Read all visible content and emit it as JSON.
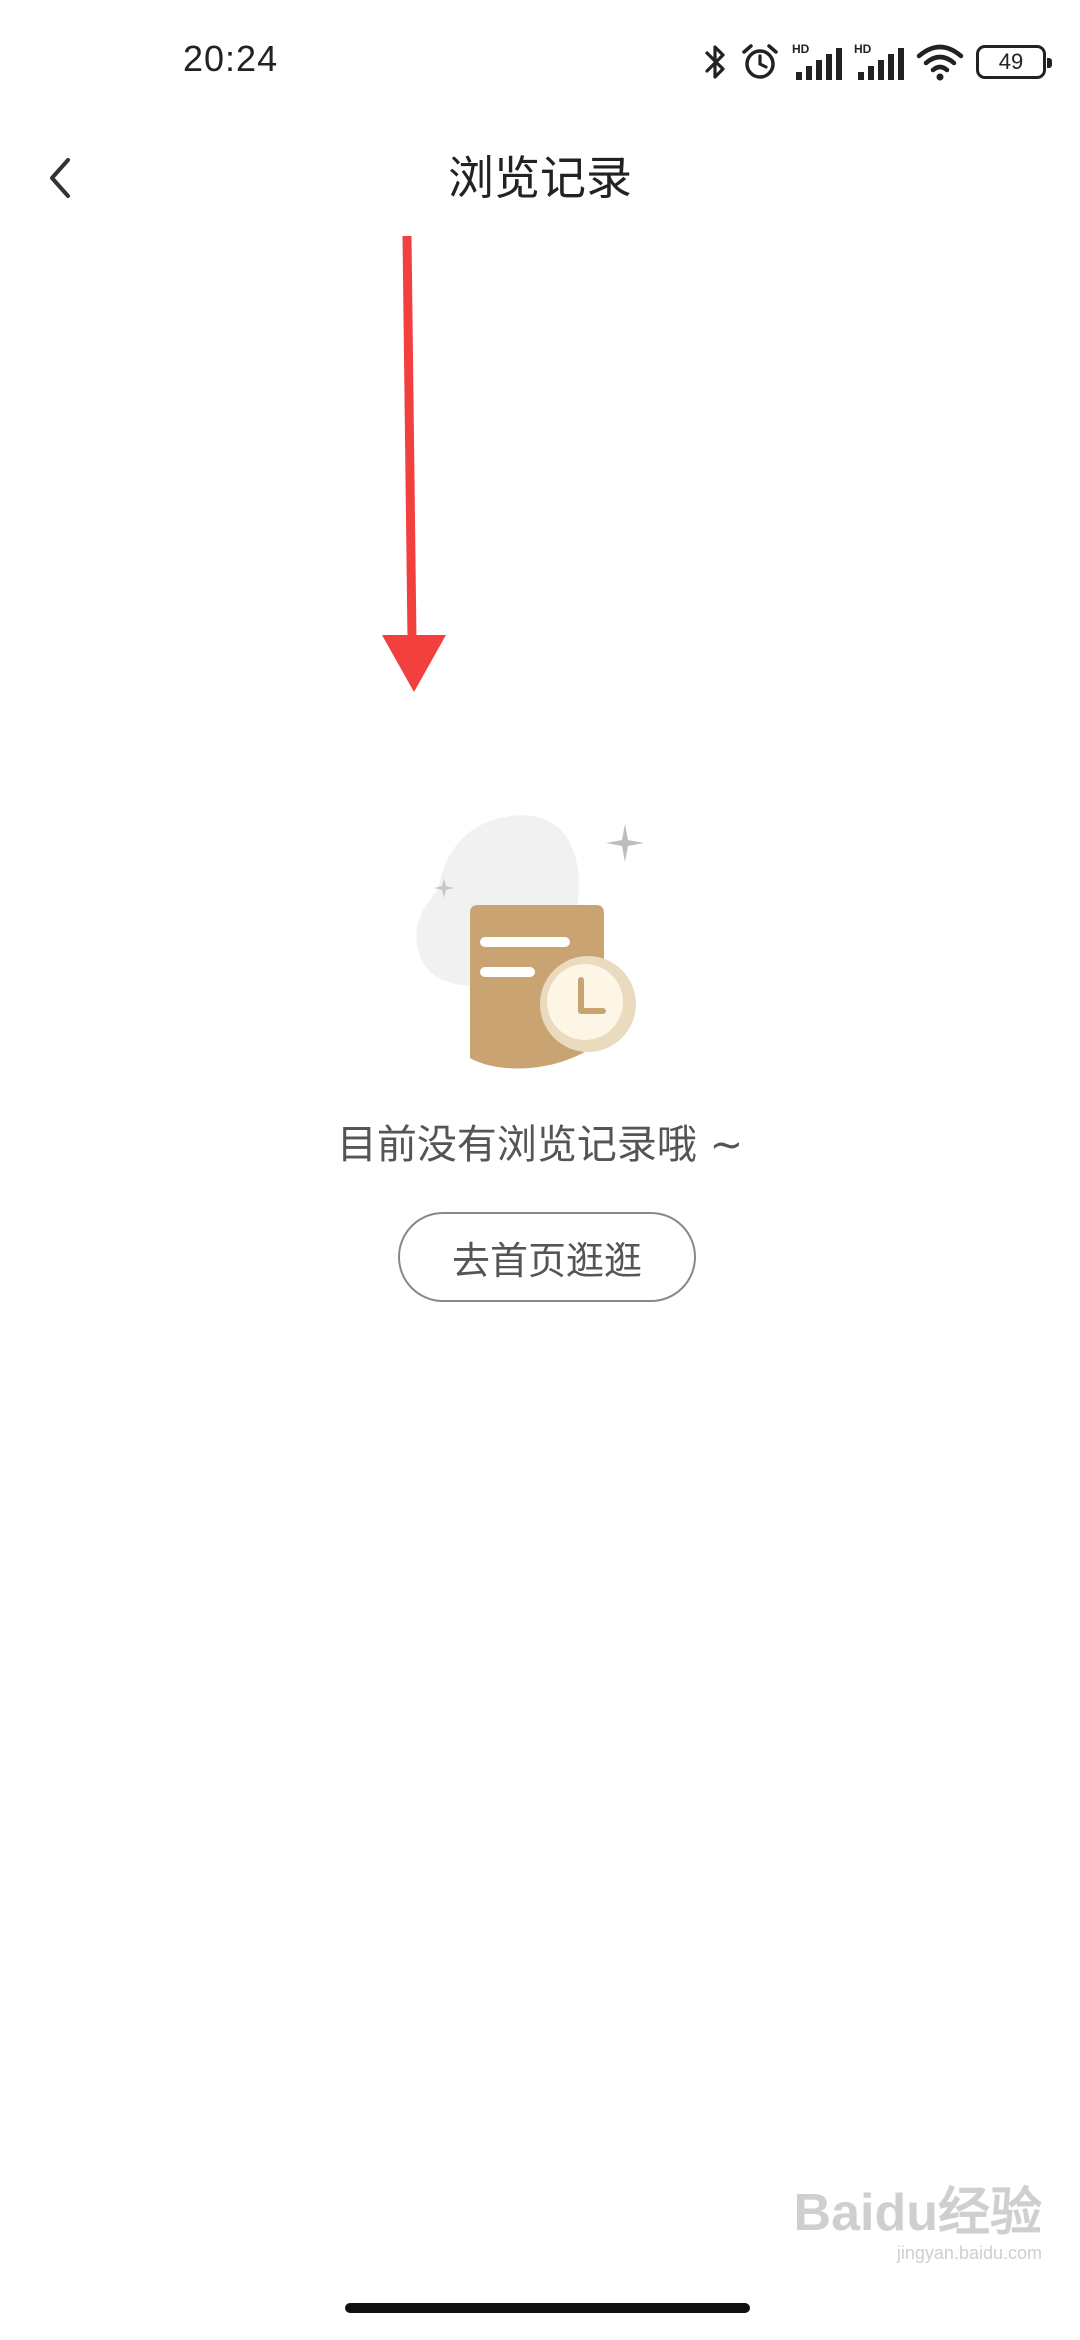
{
  "status_bar": {
    "time": "20:24",
    "battery": "49",
    "icons": [
      "bluetooth-icon",
      "alarm-icon",
      "hd-signal-icon",
      "hd-signal-icon",
      "wifi-icon",
      "battery-icon"
    ]
  },
  "header": {
    "title": "浏览记录",
    "back_icon": "chevron-left-icon"
  },
  "empty_state": {
    "message": "目前没有浏览记录哦 ~",
    "button_label": "去首页逛逛",
    "illustration": "history-document-clock-illustration"
  },
  "annotation": {
    "arrow_color": "#f2403f"
  },
  "watermark": {
    "logo": "Baidu经验",
    "url": "jingyan.baidu.com"
  },
  "colors": {
    "illustration_brown": "#c9a472",
    "clock_face": "#fdf5e6",
    "button_border": "#888888"
  }
}
